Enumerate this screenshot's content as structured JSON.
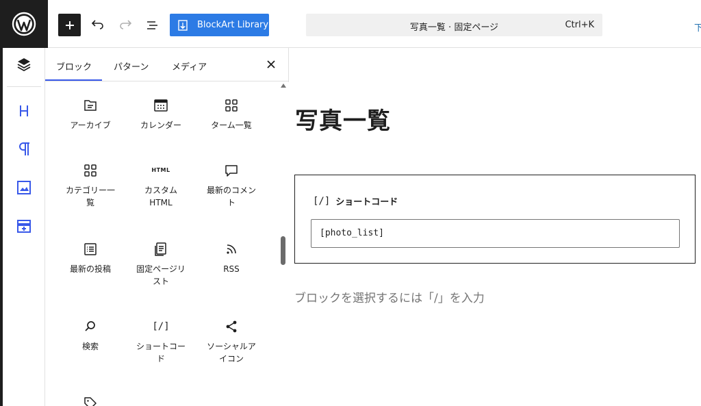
{
  "toolbar": {
    "blockart_label": "BlockArt Library",
    "command_title": "写真一覧 · 固定ページ",
    "command_shortcut": "Ctrl+K",
    "right_edge_text": "下"
  },
  "inserter": {
    "tabs": [
      {
        "label": "ブロック"
      },
      {
        "label": "パターン"
      },
      {
        "label": "メディア"
      }
    ],
    "blocks": [
      {
        "label": "アーカイブ",
        "icon": "archive-icon"
      },
      {
        "label": "カレンダー",
        "icon": "calendar-icon"
      },
      {
        "label": "ターム一覧",
        "icon": "term-list-icon"
      },
      {
        "label": "カテゴリー一覧",
        "icon": "categories-icon"
      },
      {
        "label": "カスタム HTML",
        "icon": "html-icon",
        "icon_text": "HTML"
      },
      {
        "label": "最新のコメント",
        "icon": "comment-icon"
      },
      {
        "label": "最新の投稿",
        "icon": "post-list-icon"
      },
      {
        "label": "固定ページリスト",
        "icon": "page-list-icon"
      },
      {
        "label": "RSS",
        "icon": "rss-icon"
      },
      {
        "label": "検索",
        "icon": "search-icon"
      },
      {
        "label": "ショートコード",
        "icon": "shortcode-icon",
        "icon_text": "[/]"
      },
      {
        "label": "ソーシャルアイコン",
        "icon": "share-icon"
      }
    ]
  },
  "editor": {
    "page_title": "写真一覧",
    "shortcode_block": {
      "label": "ショートコード",
      "icon_text": "[/]",
      "value": "[photo_list]"
    },
    "placeholder": "ブロックを選択するには「/」を入力"
  }
}
